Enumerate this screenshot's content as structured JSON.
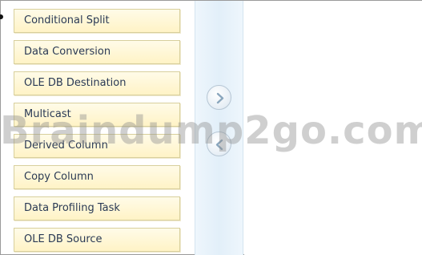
{
  "components_list": {
    "items": [
      {
        "label": "Conditional Split"
      },
      {
        "label": "Data Conversion"
      },
      {
        "label": "OLE DB Destination"
      },
      {
        "label": "Multicast"
      },
      {
        "label": "Derived Column"
      },
      {
        "label": "Copy Column"
      },
      {
        "label": "Data Profiling Task"
      },
      {
        "label": "OLE DB Source"
      }
    ]
  },
  "controls": {
    "move_right_icon": "chevron-right-icon",
    "move_left_icon": "chevron-left-icon"
  },
  "watermark": {
    "text": "Braindump2go.com"
  },
  "colors": {
    "item_background": "#fff3c6",
    "item_border": "#d8cf9c",
    "item_text": "#2a3a55",
    "middle_panel": "#e2eff9"
  }
}
